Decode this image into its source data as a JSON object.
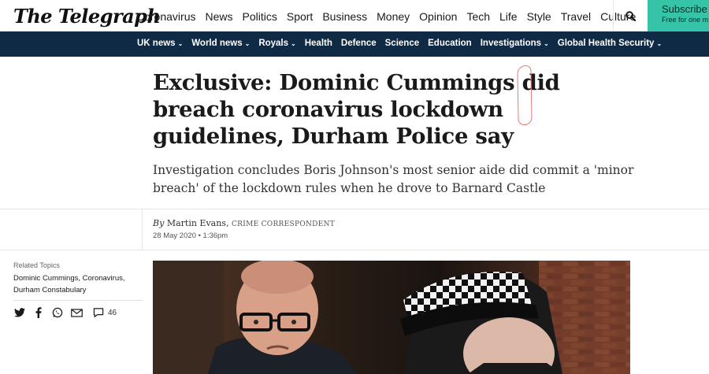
{
  "header": {
    "logo": "The Telegraph",
    "nav": [
      "Coronavirus",
      "News",
      "Politics",
      "Sport",
      "Business",
      "Money",
      "Opinion",
      "Tech",
      "Life",
      "Style",
      "Travel",
      "Culture"
    ],
    "active_nav": "News",
    "subscribe_title": "Subscribe n",
    "subscribe_sub": "Free for one m",
    "subscribe_color": "#36c4a8"
  },
  "subnav": {
    "items": [
      {
        "label": "UK news",
        "dropdown": true
      },
      {
        "label": "World news",
        "dropdown": true
      },
      {
        "label": "Royals",
        "dropdown": true
      },
      {
        "label": "Health",
        "dropdown": false
      },
      {
        "label": "Defence",
        "dropdown": false
      },
      {
        "label": "Science",
        "dropdown": false
      },
      {
        "label": "Education",
        "dropdown": false
      },
      {
        "label": "Investigations",
        "dropdown": true
      },
      {
        "label": "Global Health Security",
        "dropdown": true
      }
    ],
    "chevron": "⌄",
    "bg_color": "#0f2a44"
  },
  "article": {
    "headline_pre": "Exclusive: Dominic Cummings ",
    "headline_marked": "did breach",
    "headline_post": " coronavirus lockdown guidelines, Durham Police say",
    "standfirst": "Investigation concludes Boris Johnson's most senior aide did commit a 'minor breach' of the lockdown rules when he drove to Barnard Castle",
    "byline_prefix": "By",
    "author": "Martin Evans,",
    "role": "CRIME CORRESPONDENT",
    "date": "28 May 2020 • 1:36pm"
  },
  "sidebar": {
    "related_label": "Related Topics",
    "related_topics": [
      "Dominic Cummings,",
      "Coronavirus,",
      "Durham Constabulary"
    ],
    "comment_count": "46"
  },
  "icons": {
    "search": "search-icon",
    "share": [
      "twitter-icon",
      "facebook-icon",
      "whatsapp-icon",
      "email-icon",
      "comment-icon"
    ]
  }
}
